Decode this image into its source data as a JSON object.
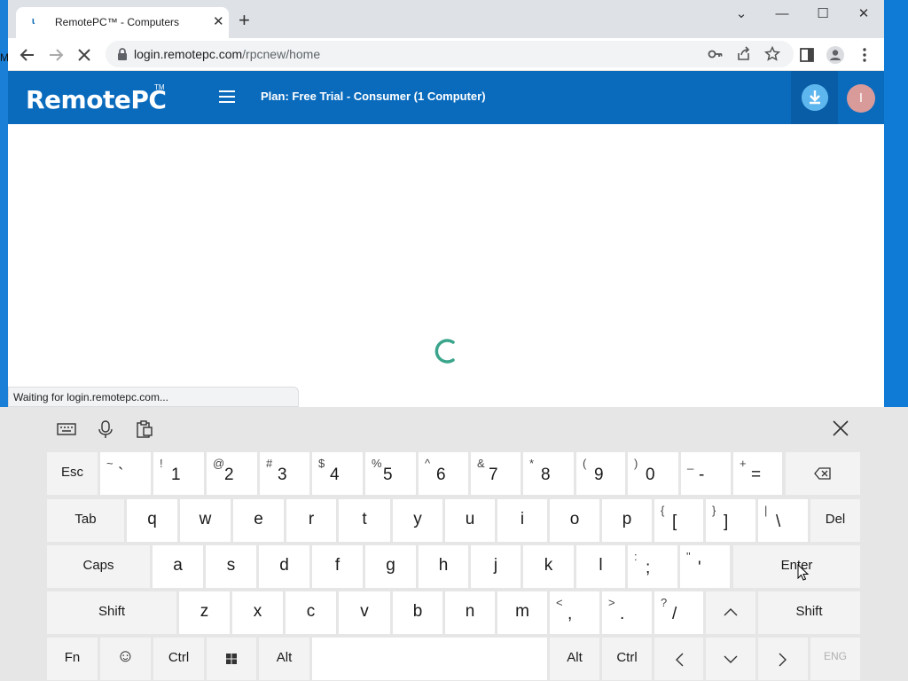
{
  "desktop": {
    "left_letter": "M"
  },
  "browser": {
    "tab_title": "RemotePC™ - Computers",
    "tab_close": "✕",
    "new_tab": "+",
    "window": {
      "minimize": "—",
      "maximize": "☐",
      "close": "✕",
      "restore": "⌄"
    },
    "url_host": "login.remotepc.com",
    "url_path": "/rpcnew/home",
    "status_text": "Waiting for login.remotepc.com..."
  },
  "site": {
    "logo": "RemotePC",
    "logo_tm": "TM",
    "plan": "Plan: Free Trial - Consumer (1 Computer)",
    "avatar_initial": "I"
  },
  "keyboard": {
    "row1": [
      {
        "label": "Esc"
      },
      {
        "sym": "~",
        "main": "`"
      },
      {
        "sym": "!",
        "main": "1"
      },
      {
        "sym": "@",
        "main": "2"
      },
      {
        "sym": "#",
        "main": "3"
      },
      {
        "sym": "$",
        "main": "4"
      },
      {
        "sym": "%",
        "main": "5"
      },
      {
        "sym": "^",
        "main": "6"
      },
      {
        "sym": "&",
        "main": "7"
      },
      {
        "sym": "*",
        "main": "8"
      },
      {
        "sym": "(",
        "main": "9"
      },
      {
        "sym": ")",
        "main": "0"
      },
      {
        "sym": "_",
        "main": "-"
      },
      {
        "sym": "+",
        "main": "="
      }
    ],
    "row2_letters": [
      "q",
      "w",
      "e",
      "r",
      "t",
      "y",
      "u",
      "i",
      "o",
      "p"
    ],
    "row2_syms": [
      {
        "sym": "{",
        "main": "["
      },
      {
        "sym": "}",
        "main": "]"
      },
      {
        "sym": "|",
        "main": "\\"
      }
    ],
    "row3_letters": [
      "a",
      "s",
      "d",
      "f",
      "g",
      "h",
      "j",
      "k",
      "l"
    ],
    "row3_syms": [
      {
        "sym": ":",
        "main": ";"
      },
      {
        "sym": "\"",
        "main": "'"
      }
    ],
    "row4_letters": [
      "z",
      "x",
      "c",
      "v",
      "b",
      "n",
      "m"
    ],
    "row4_syms": [
      {
        "sym": "<",
        "main": ","
      },
      {
        "sym": ">",
        "main": "."
      },
      {
        "sym": "?",
        "main": "/"
      }
    ],
    "labels": {
      "tab": "Tab",
      "del": "Del",
      "caps": "Caps",
      "enter": "Enter",
      "shift": "Shift",
      "fn": "Fn",
      "ctrl": "Ctrl",
      "alt": "Alt",
      "eng": "ENG"
    },
    "arrows": {
      "up": "︿",
      "down": "﹀",
      "left": "〈",
      "right": "〉"
    },
    "emoji": "☺",
    "close": "✕"
  }
}
